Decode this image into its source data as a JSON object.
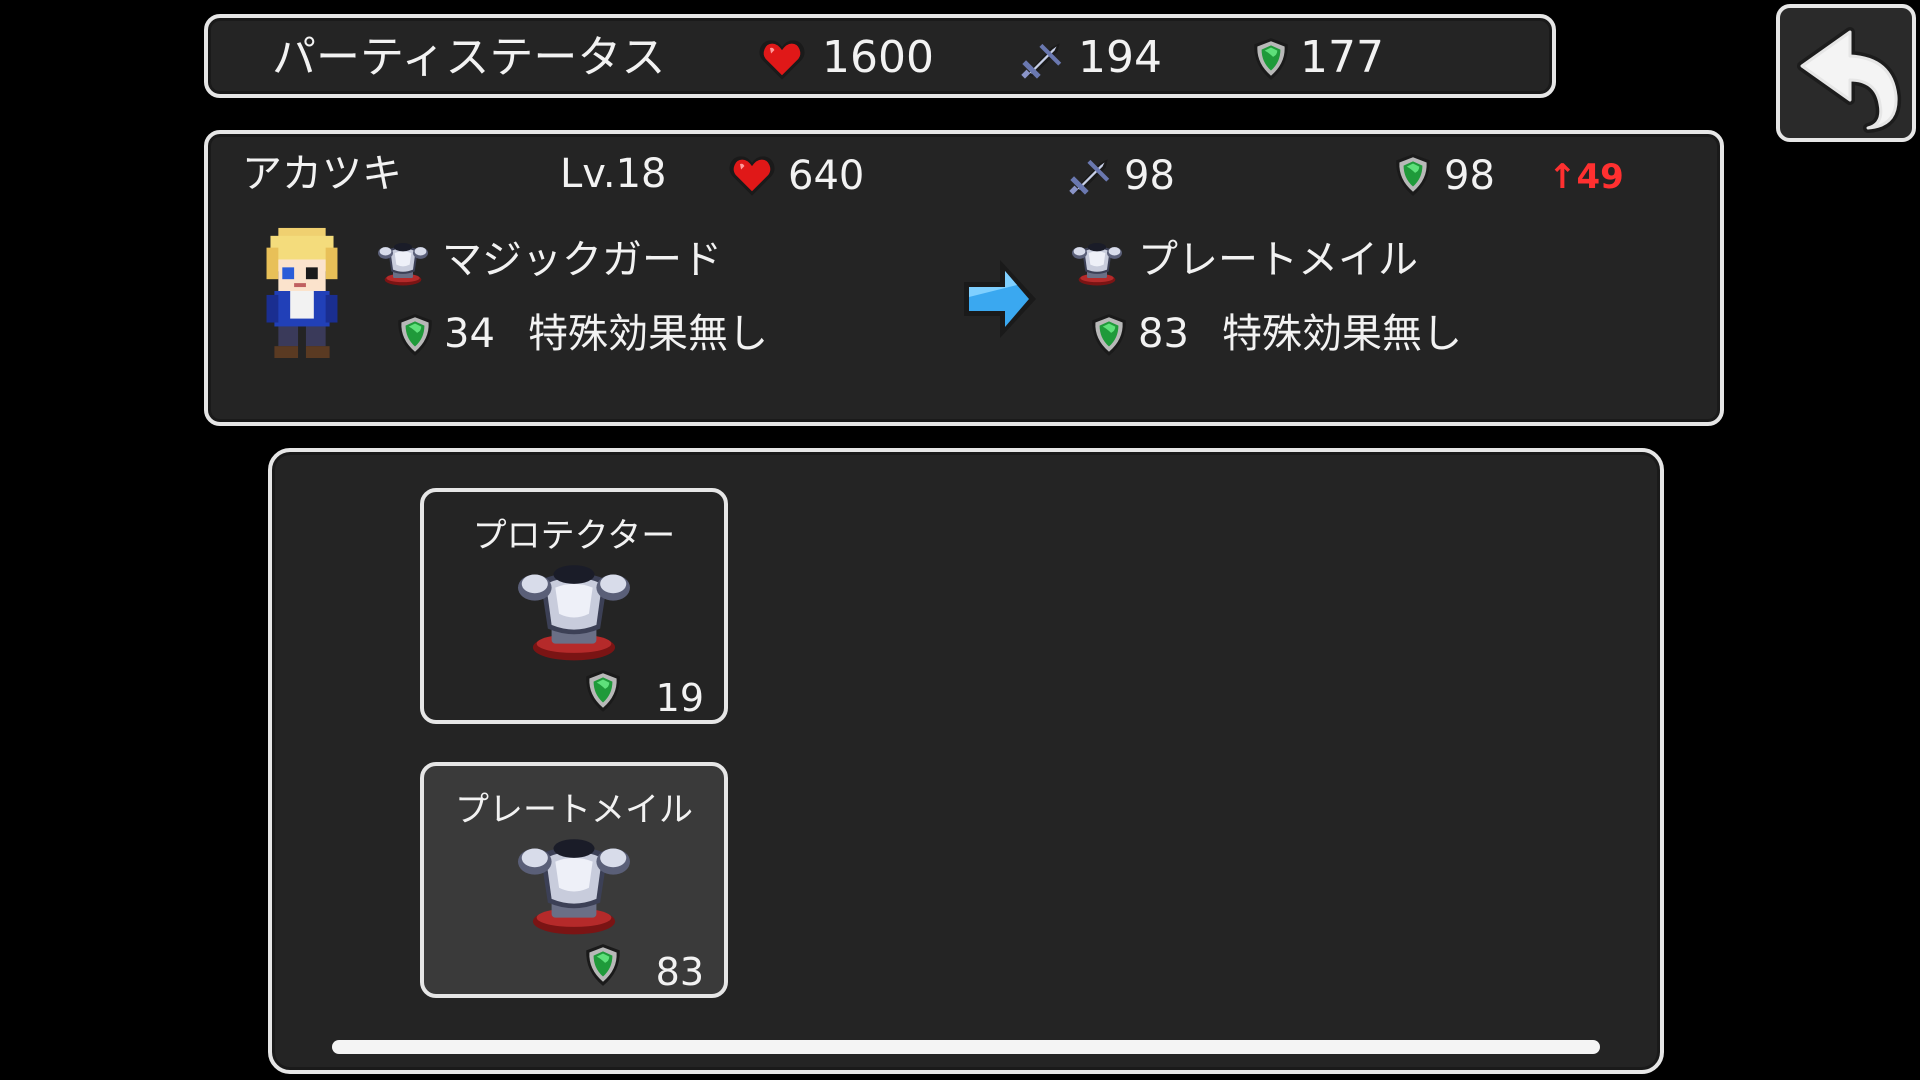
{
  "party_status": {
    "title": "パーティステータス",
    "hp": "1600",
    "attack": "194",
    "defense": "177"
  },
  "character": {
    "name": "アカツキ",
    "level": "Lv.18",
    "hp": "640",
    "attack": "98",
    "defense": "98",
    "defense_change": "↑49",
    "current_equipment": {
      "name": "マジックガード",
      "defense": "34",
      "effect": "特殊効果無し"
    },
    "new_equipment": {
      "name": "プレートメイル",
      "defense": "83",
      "effect": "特殊効果無し"
    }
  },
  "inventory": {
    "items": [
      {
        "name": "プロテクター",
        "defense": "19",
        "selected": false
      },
      {
        "name": "プレートメイル",
        "defense": "83",
        "selected": true
      }
    ]
  },
  "colors": {
    "panel_bg": "#242424",
    "border": "#e6e6e6",
    "increase": "#ff3030",
    "arrow": "#3aa8f0"
  }
}
